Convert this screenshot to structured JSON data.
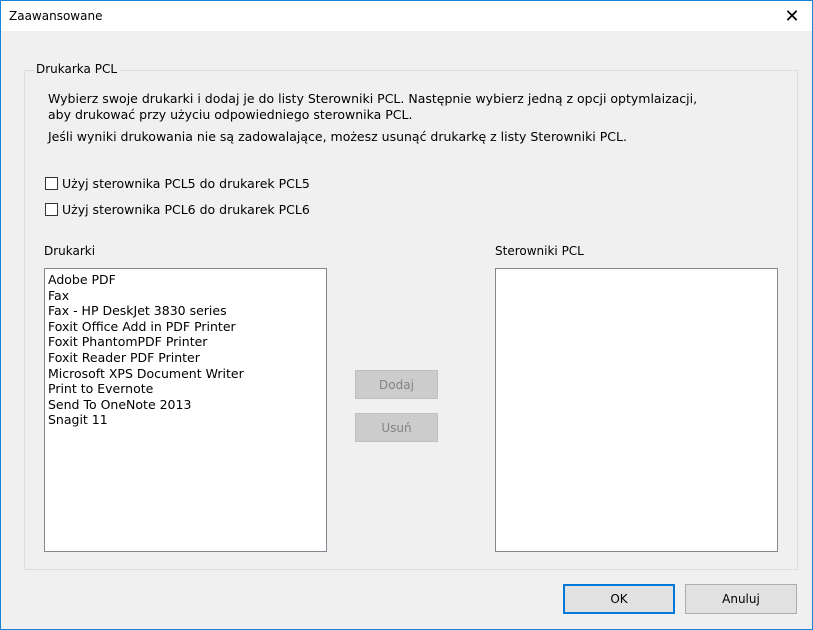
{
  "window": {
    "title": "Zaawansowane",
    "close_glyph": "✕"
  },
  "group": {
    "legend": "Drukarka PCL",
    "desc_line1": "Wybierz swoje drukarki i dodaj je do listy Sterowniki PCL. Następnie wybierz jedną z opcji optymlaizacji,",
    "desc_line2": "aby drukować przy użyciu odpowiedniego sterownika PCL.",
    "desc_line3": "Jeśli wyniki drukowania nie są zadowalające, możesz usunąć drukarkę z listy Sterowniki PCL."
  },
  "options": {
    "pcl5_label": "Użyj sterownika PCL5 do drukarek PCL5",
    "pcl5_checked": false,
    "pcl6_label": "Użyj sterownika PCL6 do drukarek PCL6",
    "pcl6_checked": false
  },
  "printers": {
    "label": "Drukarki",
    "items": [
      "Adobe PDF",
      "Fax",
      "Fax - HP DeskJet 3830 series",
      "Foxit Office Add in PDF Printer",
      "Foxit PhantomPDF Printer",
      "Foxit Reader PDF Printer",
      "Microsoft XPS Document Writer",
      "Print to Evernote",
      "Send To OneNote 2013",
      "Snagit 11"
    ]
  },
  "drivers": {
    "label": "Sterowniki PCL",
    "items": []
  },
  "buttons": {
    "add": "Dodaj",
    "remove": "Usuń",
    "ok": "OK",
    "cancel": "Anuluj"
  },
  "icons": {
    "checkbox": "checkbox-icon",
    "close": "close-icon"
  },
  "colors": {
    "accent": "#0078d7",
    "disabled_text": "#838383"
  }
}
